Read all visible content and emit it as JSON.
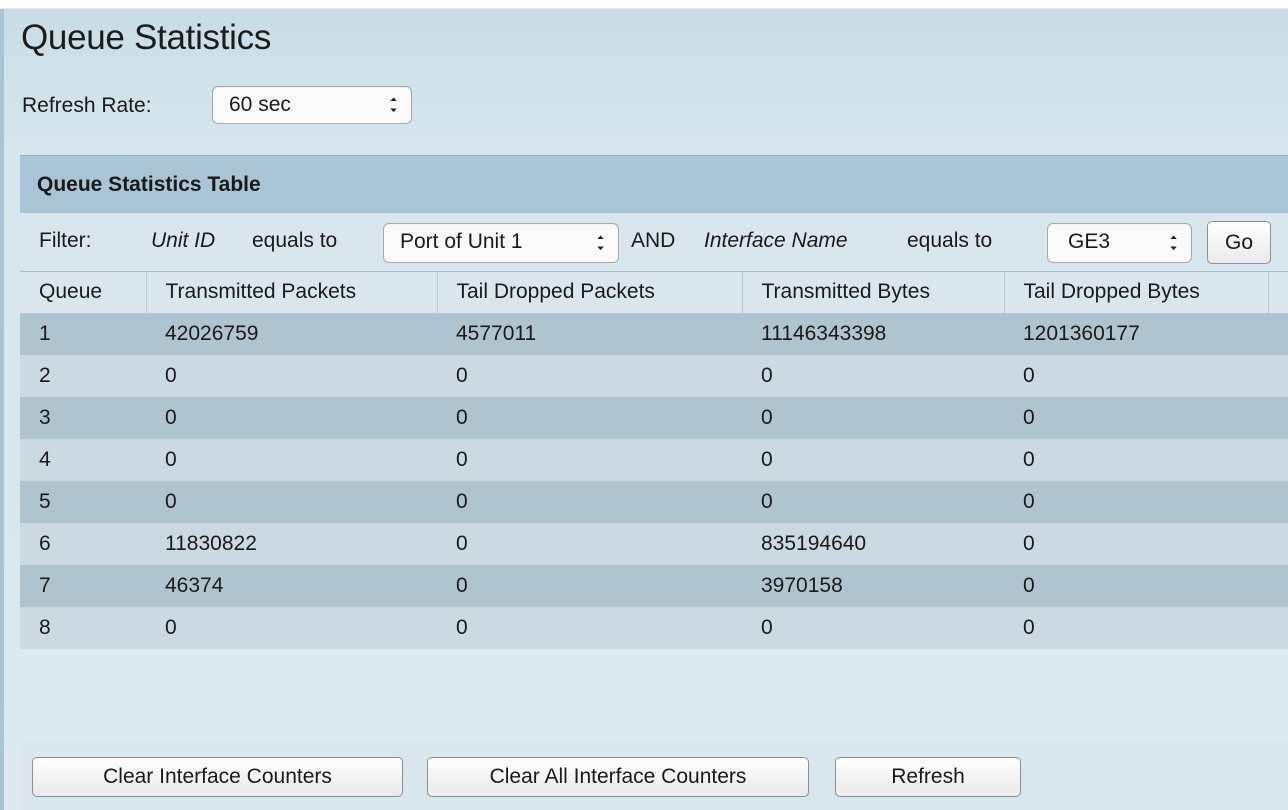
{
  "page": {
    "title": "Queue Statistics"
  },
  "refresh": {
    "label": "Refresh Rate:",
    "value": "60 sec"
  },
  "table": {
    "title": "Queue Statistics Table",
    "filter": {
      "label": "Filter:",
      "field1": "Unit ID",
      "equals1": "equals to",
      "unit_value": "Port of Unit 1",
      "and": "AND",
      "field2": "Interface Name",
      "equals2": "equals to",
      "interface_value": "GE3",
      "go_label": "Go"
    },
    "columns": [
      "Queue",
      "Transmitted Packets",
      "Tail Dropped Packets",
      "Transmitted Bytes",
      "Tail Dropped Bytes"
    ],
    "rows": [
      [
        "1",
        "42026759",
        "4577011",
        "11146343398",
        "1201360177"
      ],
      [
        "2",
        "0",
        "0",
        "0",
        "0"
      ],
      [
        "3",
        "0",
        "0",
        "0",
        "0"
      ],
      [
        "4",
        "0",
        "0",
        "0",
        "0"
      ],
      [
        "5",
        "0",
        "0",
        "0",
        "0"
      ],
      [
        "6",
        "11830822",
        "0",
        "835194640",
        "0"
      ],
      [
        "7",
        "46374",
        "0",
        "3970158",
        "0"
      ],
      [
        "8",
        "0",
        "0",
        "0",
        "0"
      ]
    ],
    "buttons": {
      "clear_interface": "Clear Interface Counters",
      "clear_all": "Clear All Interface Counters",
      "refresh": "Refresh"
    }
  },
  "icons": {
    "select_arrows": "up-down-arrows-icon",
    "arrow_glyph": "▲▼"
  }
}
